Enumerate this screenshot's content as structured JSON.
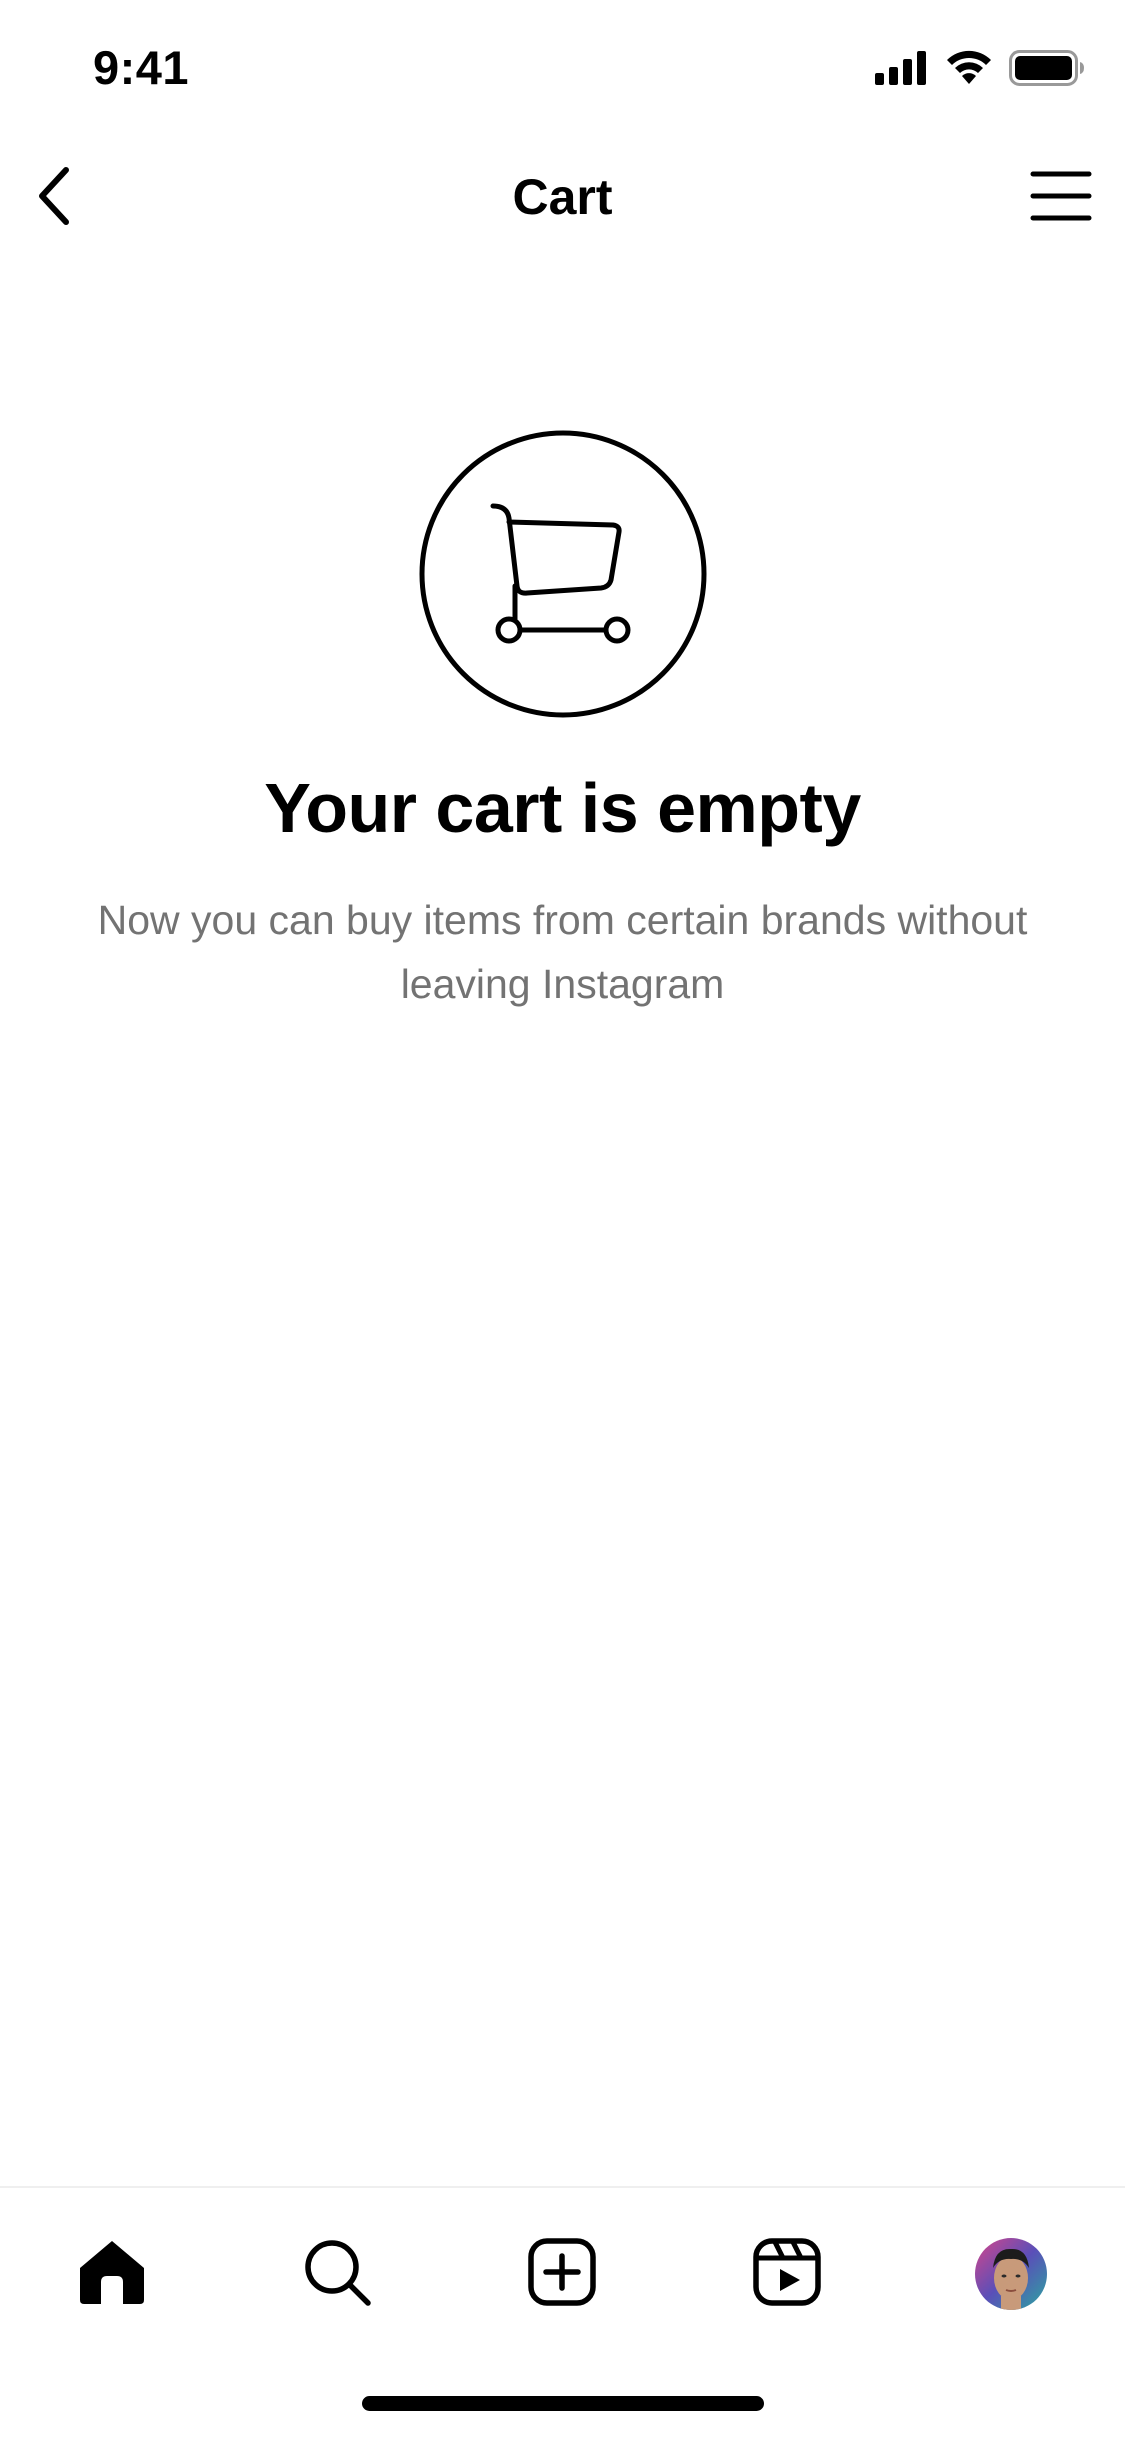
{
  "status_bar": {
    "time": "9:41",
    "icons": [
      "cellular-signal-icon",
      "wifi-icon",
      "battery-icon"
    ]
  },
  "header": {
    "title": "Cart",
    "back_icon": "chevron-left-icon",
    "menu_icon": "hamburger-menu-icon"
  },
  "empty_state": {
    "icon": "shopping-cart-icon",
    "title": "Your cart is empty",
    "subtitle": "Now you can buy items from certain brands without leaving Instagram"
  },
  "tab_bar": {
    "tabs": [
      {
        "name": "home",
        "icon": "home-icon",
        "selected": true
      },
      {
        "name": "search",
        "icon": "search-icon",
        "selected": false
      },
      {
        "name": "create",
        "icon": "add-post-icon",
        "selected": false
      },
      {
        "name": "reels",
        "icon": "reels-icon",
        "selected": false
      },
      {
        "name": "profile",
        "icon": "profile-avatar",
        "selected": false
      }
    ]
  },
  "colors": {
    "text_primary": "#000000",
    "text_secondary": "#737373",
    "divider": "#efefef",
    "background": "#ffffff"
  }
}
